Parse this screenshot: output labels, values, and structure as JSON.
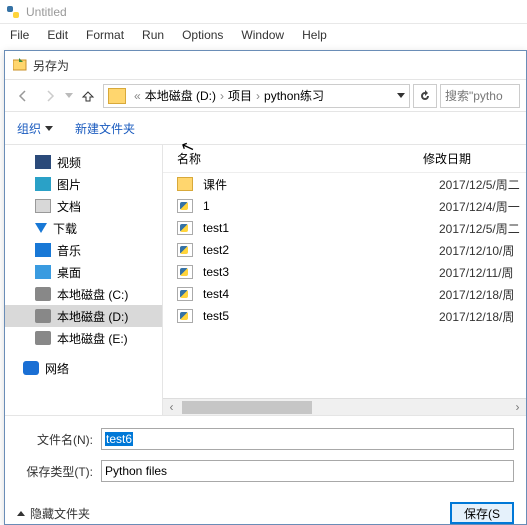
{
  "ide": {
    "title": "Untitled",
    "menu": [
      "File",
      "Edit",
      "Format",
      "Run",
      "Options",
      "Window",
      "Help"
    ]
  },
  "dialog": {
    "title": "另存为",
    "breadcrumb": {
      "drive": "本地磁盘 (D:)",
      "folder1": "项目",
      "folder2": "python练习"
    },
    "search_placeholder": "搜索\"pytho",
    "organize": "组织",
    "new_folder": "新建文件夹",
    "columns": {
      "name": "名称",
      "date": "修改日期"
    },
    "tree": [
      {
        "label": "视频",
        "icon": "video"
      },
      {
        "label": "图片",
        "icon": "pic"
      },
      {
        "label": "文档",
        "icon": "doc"
      },
      {
        "label": "下载",
        "icon": "down"
      },
      {
        "label": "音乐",
        "icon": "music"
      },
      {
        "label": "桌面",
        "icon": "desk"
      },
      {
        "label": "本地磁盘 (C:)",
        "icon": "disk"
      },
      {
        "label": "本地磁盘 (D:)",
        "icon": "disk",
        "selected": true
      },
      {
        "label": "本地磁盘 (E:)",
        "icon": "disk"
      }
    ],
    "network_label": "网络",
    "files": [
      {
        "name": "课件",
        "type": "folder",
        "date": "2017/12/5/周二"
      },
      {
        "name": "1",
        "type": "py",
        "date": "2017/12/4/周一"
      },
      {
        "name": "test1",
        "type": "py",
        "date": "2017/12/5/周二"
      },
      {
        "name": "test2",
        "type": "py",
        "date": "2017/12/10/周"
      },
      {
        "name": "test3",
        "type": "py",
        "date": "2017/12/11/周"
      },
      {
        "name": "test4",
        "type": "py",
        "date": "2017/12/18/周"
      },
      {
        "name": "test5",
        "type": "py",
        "date": "2017/12/18/周"
      }
    ],
    "filename_label": "文件名(N):",
    "filename_value": "test6",
    "filetype_label": "保存类型(T):",
    "filetype_value": "Python files",
    "hide_folders": "隐藏文件夹",
    "save_button": "保存(S"
  }
}
